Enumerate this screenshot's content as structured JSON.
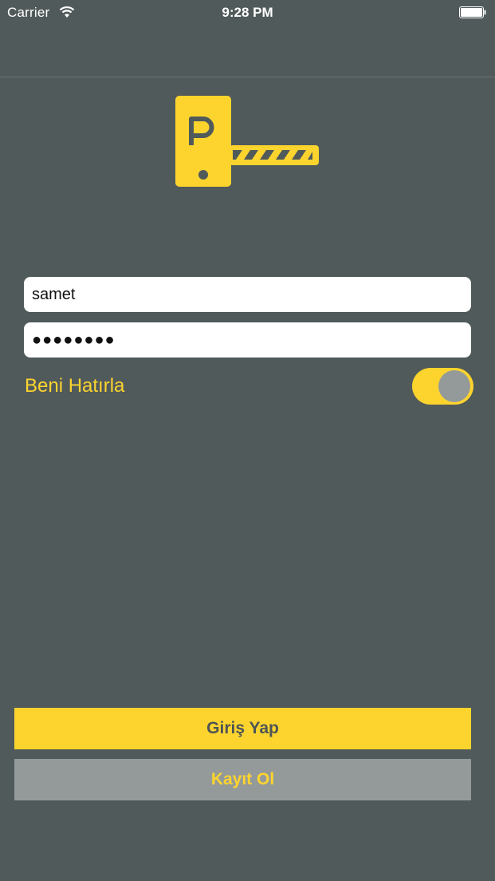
{
  "colors": {
    "background": "#515a5a",
    "accent": "#fdd42e",
    "secondary_button": "#949a9a"
  },
  "status_bar": {
    "carrier": "Carrier",
    "time": "9:28 PM",
    "icons": [
      "wifi-icon",
      "battery-icon"
    ]
  },
  "logo": {
    "icon": "parking-barrier-icon",
    "letter": "P"
  },
  "login_form": {
    "username_value": "samet",
    "password_value": "●●●●●●●●",
    "remember_label": "Beni Hatırla",
    "remember_on": true
  },
  "actions": {
    "login_label": "Giriş Yap",
    "register_label": "Kayıt Ol"
  }
}
